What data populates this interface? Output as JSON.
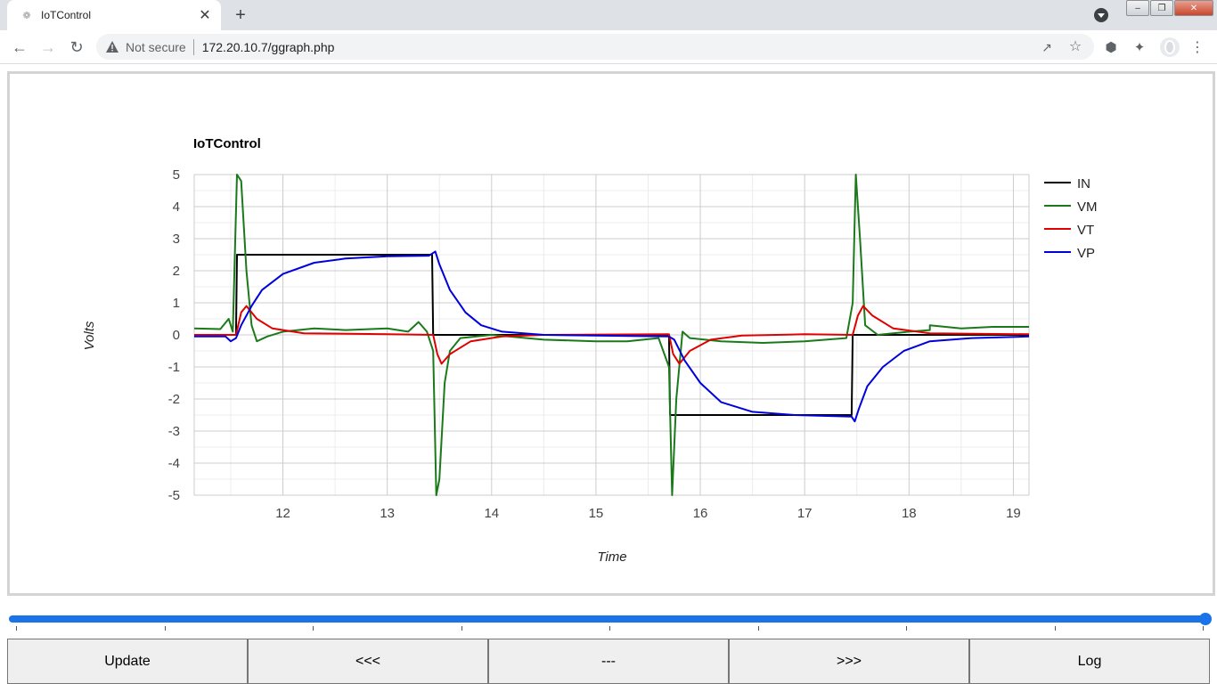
{
  "browser": {
    "tab_title": "IoTControl",
    "omnibox_security": "Not secure",
    "url": "172.20.10.7/ggraph.php"
  },
  "chart_data": {
    "type": "line",
    "title": "IoTControl",
    "xlabel": "Time",
    "ylabel": "Volts",
    "xlim": [
      11.15,
      19.15
    ],
    "ylim": [
      -5,
      5
    ],
    "x_ticks": [
      "12",
      "13",
      "14",
      "15",
      "16",
      "17",
      "18",
      "19"
    ],
    "y_ticks": [
      "5",
      "4",
      "3",
      "2",
      "1",
      "0",
      "-1",
      "-2",
      "-3",
      "-4",
      "-5"
    ],
    "grid": true,
    "legend_position": "right",
    "series": [
      {
        "name": "IN",
        "color": "#000000",
        "points": [
          [
            11.15,
            0
          ],
          [
            11.55,
            0
          ],
          [
            11.56,
            2.5
          ],
          [
            13.43,
            2.5
          ],
          [
            13.44,
            0
          ],
          [
            15.7,
            0
          ],
          [
            15.71,
            -2.5
          ],
          [
            17.45,
            -2.5
          ],
          [
            17.46,
            0
          ],
          [
            19.15,
            0
          ]
        ]
      },
      {
        "name": "VM",
        "color": "#1a7a1a",
        "points": [
          [
            11.15,
            0.2
          ],
          [
            11.4,
            0.18
          ],
          [
            11.48,
            0.5
          ],
          [
            11.52,
            0.1
          ],
          [
            11.56,
            5.0
          ],
          [
            11.6,
            4.8
          ],
          [
            11.65,
            2.0
          ],
          [
            11.7,
            0.3
          ],
          [
            11.75,
            -0.2
          ],
          [
            11.85,
            -0.05
          ],
          [
            12.0,
            0.1
          ],
          [
            12.3,
            0.2
          ],
          [
            12.6,
            0.15
          ],
          [
            13.0,
            0.2
          ],
          [
            13.2,
            0.1
          ],
          [
            13.3,
            0.4
          ],
          [
            13.38,
            0.1
          ],
          [
            13.44,
            -0.5
          ],
          [
            13.47,
            -5.0
          ],
          [
            13.5,
            -4.5
          ],
          [
            13.55,
            -1.5
          ],
          [
            13.6,
            -0.5
          ],
          [
            13.7,
            -0.1
          ],
          [
            14.0,
            0.0
          ],
          [
            14.5,
            -0.15
          ],
          [
            15.0,
            -0.2
          ],
          [
            15.3,
            -0.2
          ],
          [
            15.6,
            -0.1
          ],
          [
            15.7,
            -1.0
          ],
          [
            15.73,
            -5.0
          ],
          [
            15.77,
            -2.0
          ],
          [
            15.83,
            0.1
          ],
          [
            15.9,
            -0.1
          ],
          [
            16.2,
            -0.2
          ],
          [
            16.6,
            -0.25
          ],
          [
            17.0,
            -0.2
          ],
          [
            17.4,
            -0.1
          ],
          [
            17.46,
            1.0
          ],
          [
            17.49,
            5.0
          ],
          [
            17.53,
            3.0
          ],
          [
            17.58,
            0.3
          ],
          [
            17.7,
            0.0
          ],
          [
            18.0,
            0.1
          ],
          [
            18.2,
            0.15
          ],
          [
            18.2,
            0.3
          ],
          [
            18.5,
            0.2
          ],
          [
            18.8,
            0.25
          ],
          [
            19.15,
            0.25
          ]
        ]
      },
      {
        "name": "VT",
        "color": "#e00000",
        "points": [
          [
            11.15,
            0.0
          ],
          [
            11.55,
            0.0
          ],
          [
            11.6,
            0.7
          ],
          [
            11.65,
            0.9
          ],
          [
            11.75,
            0.5
          ],
          [
            11.9,
            0.2
          ],
          [
            12.2,
            0.05
          ],
          [
            13.0,
            0.02
          ],
          [
            13.44,
            0.0
          ],
          [
            13.48,
            -0.6
          ],
          [
            13.52,
            -0.9
          ],
          [
            13.6,
            -0.6
          ],
          [
            13.8,
            -0.2
          ],
          [
            14.1,
            -0.05
          ],
          [
            14.5,
            0.0
          ],
          [
            15.7,
            0.02
          ],
          [
            15.74,
            -0.6
          ],
          [
            15.8,
            -0.9
          ],
          [
            15.9,
            -0.5
          ],
          [
            16.1,
            -0.15
          ],
          [
            16.4,
            -0.02
          ],
          [
            17.0,
            0.02
          ],
          [
            17.46,
            0.0
          ],
          [
            17.51,
            0.6
          ],
          [
            17.56,
            0.9
          ],
          [
            17.65,
            0.6
          ],
          [
            17.85,
            0.2
          ],
          [
            18.2,
            0.05
          ],
          [
            19.15,
            0.02
          ]
        ]
      },
      {
        "name": "VP",
        "color": "#0000dd",
        "points": [
          [
            11.15,
            -0.05
          ],
          [
            11.45,
            -0.05
          ],
          [
            11.5,
            -0.2
          ],
          [
            11.55,
            -0.1
          ],
          [
            11.6,
            0.3
          ],
          [
            11.7,
            0.9
          ],
          [
            11.8,
            1.4
          ],
          [
            12.0,
            1.9
          ],
          [
            12.3,
            2.25
          ],
          [
            12.6,
            2.38
          ],
          [
            13.0,
            2.45
          ],
          [
            13.4,
            2.47
          ],
          [
            13.46,
            2.6
          ],
          [
            13.5,
            2.2
          ],
          [
            13.6,
            1.4
          ],
          [
            13.75,
            0.7
          ],
          [
            13.9,
            0.3
          ],
          [
            14.1,
            0.1
          ],
          [
            14.5,
            0.0
          ],
          [
            15.7,
            -0.05
          ],
          [
            15.75,
            -0.15
          ],
          [
            15.85,
            -0.8
          ],
          [
            16.0,
            -1.5
          ],
          [
            16.2,
            -2.1
          ],
          [
            16.5,
            -2.4
          ],
          [
            16.9,
            -2.5
          ],
          [
            17.45,
            -2.55
          ],
          [
            17.48,
            -2.7
          ],
          [
            17.52,
            -2.3
          ],
          [
            17.6,
            -1.6
          ],
          [
            17.75,
            -1.0
          ],
          [
            17.95,
            -0.5
          ],
          [
            18.2,
            -0.2
          ],
          [
            18.6,
            -0.1
          ],
          [
            19.15,
            -0.05
          ]
        ]
      }
    ]
  },
  "slider": {
    "value": 1.0
  },
  "buttons": {
    "update": "Update",
    "back": "<<<",
    "dash": "---",
    "forward": ">>>",
    "log": "Log"
  }
}
